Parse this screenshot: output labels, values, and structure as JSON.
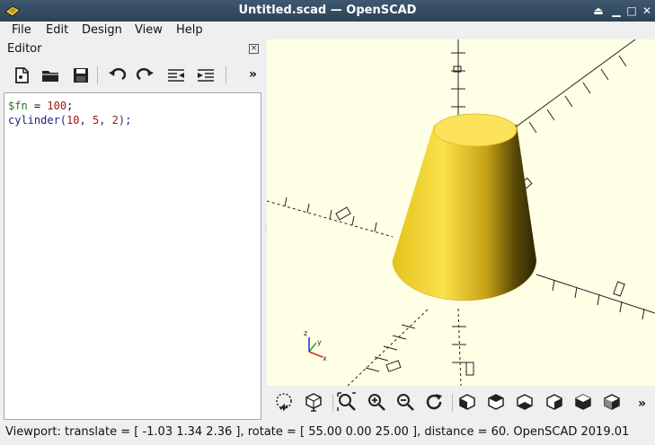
{
  "window": {
    "title": "Untitled.scad — OpenSCAD"
  },
  "menu": {
    "file": "File",
    "edit": "Edit",
    "design": "Design",
    "view": "View",
    "help": "Help"
  },
  "editor": {
    "header": "Editor",
    "code_line1": {
      "var": "$fn",
      "op": " = ",
      "num": "100",
      "end": ";"
    },
    "code_line2": {
      "fn": "cylinder(",
      "a": "10",
      "s1": ", ",
      "b": "5",
      "s2": ", ",
      "c": "2",
      "end": ");"
    }
  },
  "toolbar": {
    "more": "»"
  },
  "view_toolbar": {
    "more": "»"
  },
  "status": {
    "text": "Viewport: translate = [ -1.03 1.34 2.36 ], rotate = [ 55.00 0.00 25.00 ], distance = 60. OpenSCAD 2019.01"
  },
  "axes": {
    "x": "x",
    "y": "y",
    "z": "z"
  },
  "colors": {
    "viewport_bg": "#ffffe5",
    "model_fill": "#f7d23a",
    "titlebar": "#34495e"
  }
}
